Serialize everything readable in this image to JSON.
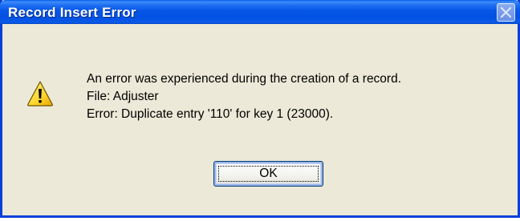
{
  "dialog": {
    "title": "Record Insert Error",
    "close_icon": "close-icon",
    "warning_icon": "warning-icon",
    "message_lines": [
      "An error was experienced during the creation of a record.",
      "File: Adjuster",
      "Error: Duplicate entry '110' for key 1 (23000)."
    ],
    "ok_label": "OK"
  },
  "colors": {
    "title_bar": "#0656e6",
    "dialog_bg": "#ece9d8",
    "warning_yellow": "#ffd52b"
  }
}
